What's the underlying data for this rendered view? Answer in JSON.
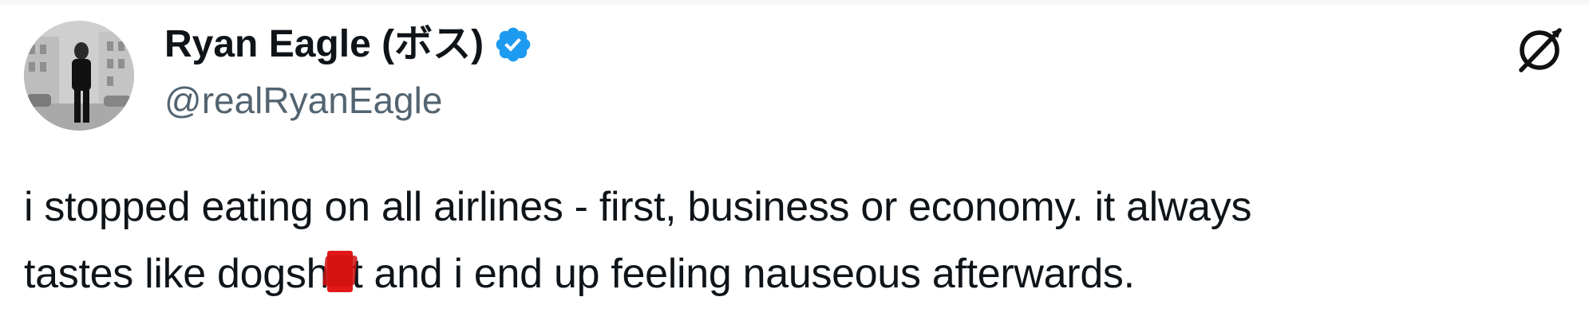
{
  "tweet": {
    "author": {
      "display_name": "Ryan Eagle (ボス)",
      "handle": "@realRyanEagle",
      "verified": true
    },
    "text": {
      "line1": "i stopped eating on all airlines - first, business or economy. it always",
      "line2_before": "tastes like dogsh",
      "line2_after": "t and i end up feeling nauseous afterwards."
    },
    "icons": {
      "verified": "verified-badge-icon",
      "brand": "brand-logo-icon",
      "censor": "censor-mark"
    },
    "colors": {
      "text": "#0f1419",
      "secondary": "#536471",
      "verified": "#1d9bf0",
      "censor": "#e11818"
    }
  }
}
